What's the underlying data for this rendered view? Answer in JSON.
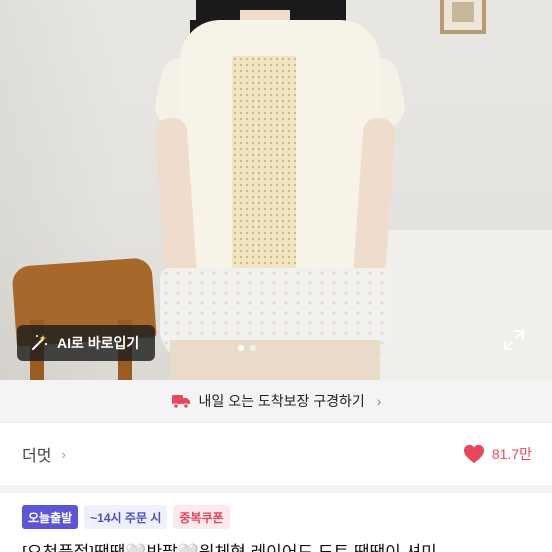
{
  "product_image": {
    "ai_button_label": "AI로 바로입기",
    "ai_icon": "magic-wand-icon",
    "expand_icon": "expand-icon",
    "slide_count": 2,
    "active_slide": 1
  },
  "delivery_banner": {
    "icon": "truck-icon",
    "text": "내일 오는 도착보장 구경하기",
    "chevron": "›"
  },
  "shop": {
    "name": "더멋",
    "chevron": "›",
    "likes": "81.7만",
    "heart_icon": "heart-icon",
    "heart_color": "#e8475b"
  },
  "badges": {
    "today": "오늘출발",
    "time": "~14시 주문 시",
    "coupon": "중복쿠폰"
  },
  "product": {
    "title": "[오천품절]땡땡🤍반팔🤍원체형 레이어드 도트 땡땡이 셔미"
  }
}
